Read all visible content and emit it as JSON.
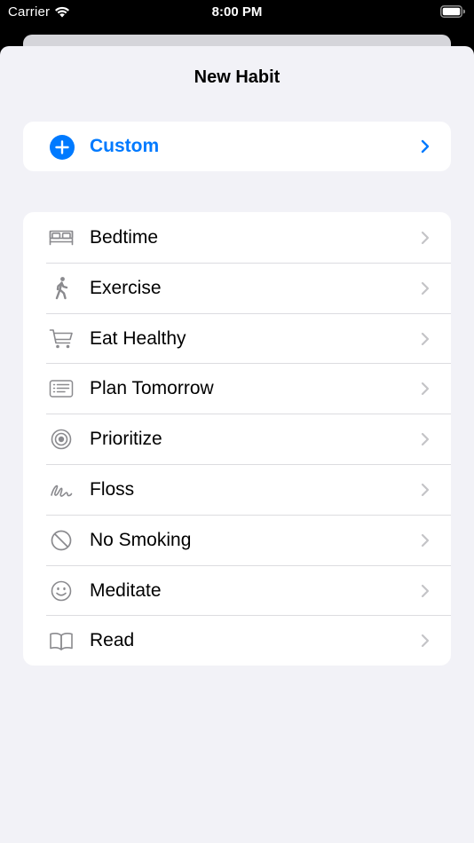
{
  "status_bar": {
    "carrier": "Carrier",
    "time": "8:00 PM"
  },
  "sheet": {
    "title": "New Habit"
  },
  "custom": {
    "label": "Custom",
    "icon": "plus-circle-icon"
  },
  "habits": [
    {
      "label": "Bedtime",
      "icon": "bed-icon"
    },
    {
      "label": "Exercise",
      "icon": "walking-figure-icon"
    },
    {
      "label": "Eat Healthy",
      "icon": "cart-icon"
    },
    {
      "label": "Plan Tomorrow",
      "icon": "list-icon"
    },
    {
      "label": "Prioritize",
      "icon": "target-icon"
    },
    {
      "label": "Floss",
      "icon": "scribble-icon"
    },
    {
      "label": "No Smoking",
      "icon": "prohibited-icon"
    },
    {
      "label": "Meditate",
      "icon": "smiley-icon"
    },
    {
      "label": "Read",
      "icon": "book-icon"
    }
  ],
  "colors": {
    "accent": "#007aff",
    "background": "#f2f2f7",
    "icon_gray": "#8a8a8e",
    "chevron_gray": "#c4c4c7"
  }
}
